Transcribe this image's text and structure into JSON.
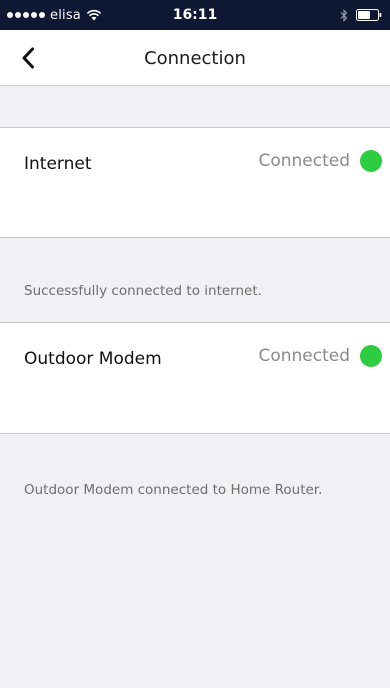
{
  "status_bar": {
    "carrier": "elisa",
    "time": "16:11"
  },
  "nav": {
    "title": "Connection"
  },
  "connections": [
    {
      "label": "Internet",
      "status": "Connected",
      "note": "Successfully connected to internet."
    },
    {
      "label": "Outdoor Modem",
      "status": "Connected",
      "note": "Outdoor Modem connected to Home Router."
    }
  ],
  "colors": {
    "status_bar_bg": "#0f1832",
    "connected_dot": "#2ecc40",
    "page_bg": "#f0f0f5"
  }
}
